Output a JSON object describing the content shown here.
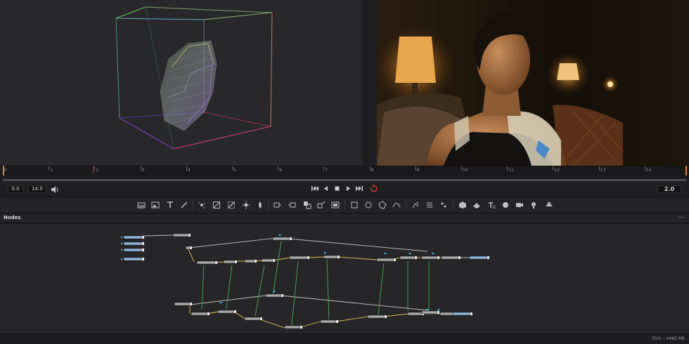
{
  "ruler": {
    "ticks": [
      "0",
      "1",
      "2",
      "3",
      "4",
      "5",
      "6",
      "7",
      "8",
      "9",
      "10",
      "11",
      "12",
      "13",
      "14"
    ]
  },
  "transport": {
    "current_time": "0.0",
    "duration": "14.0",
    "render_frame": "2.0",
    "loop_color": "#e5462f"
  },
  "toolbar": {
    "icons": [
      "background-icon",
      "image-icon",
      "text-icon",
      "paint-icon",
      "particle-emitter-icon",
      "gradient-icon",
      "color-corrector-icon",
      "brightness-icon",
      "blur-icon",
      "loader-icon",
      "saver-icon",
      "merge-icon",
      "transform-icon",
      "mask-icon",
      "rectangle-mask-icon",
      "ellipse-mask-icon",
      "polygon-mask-icon",
      "bspline-mask-icon",
      "particle-render-icon",
      "particle-force-icon",
      "particle-style-icon",
      "shape-3d-icon",
      "merge-3d-icon",
      "text-3d-icon",
      "render-3d-icon",
      "camera-3d-icon",
      "light-3d-icon",
      "renderer-3d-icon"
    ]
  },
  "nodes": {
    "title": "Nodes",
    "menu": "⋯"
  },
  "status": {
    "memory": "55% – 4482 MB"
  },
  "colors": {
    "loader_node": "#8fb7dc",
    "tool_node": "#a8a8a8",
    "image_link": "#e0c252",
    "mask_link": "#4fa95a",
    "main_link": "#bdbdbd",
    "input_arrow": "#3ab6e6"
  }
}
